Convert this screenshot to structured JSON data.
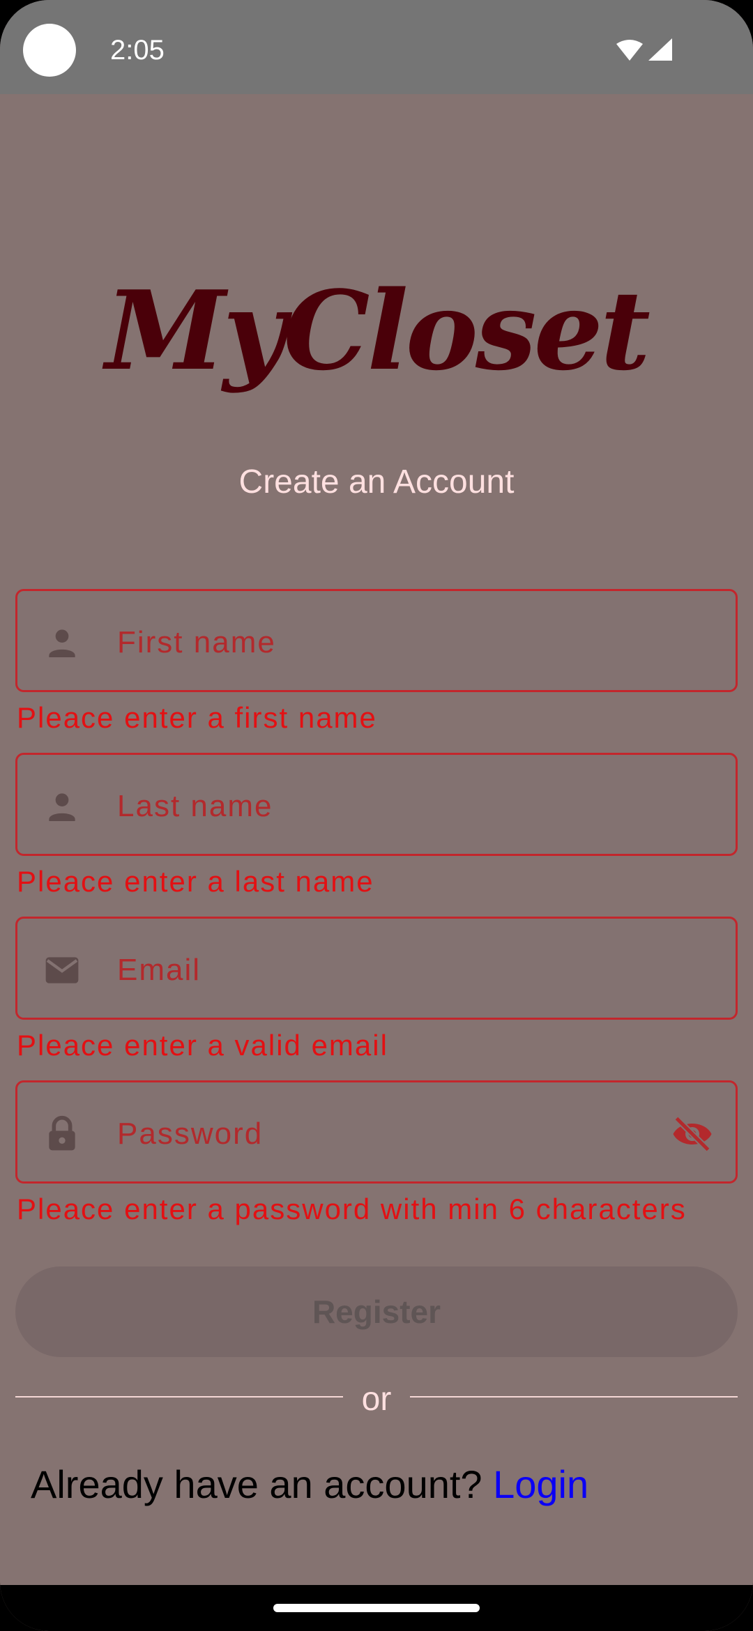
{
  "status_bar": {
    "time": "2:05",
    "icons": [
      "wifi-icon",
      "cell-signal-icon"
    ]
  },
  "app": {
    "logo": "MyCloset",
    "subtitle": "Create an Account"
  },
  "form": {
    "first_name": {
      "placeholder": "First name",
      "icon": "person-icon",
      "error": "Pleace enter a first name"
    },
    "last_name": {
      "placeholder": "Last name",
      "icon": "person-icon",
      "error": "Pleace enter a last name"
    },
    "email": {
      "placeholder": "Email",
      "icon": "mail-icon",
      "error": "Pleace enter a valid email"
    },
    "password": {
      "placeholder": "Password",
      "icon": "lock-icon",
      "toggle_icon": "eye-off-icon",
      "error": "Pleace enter a password with min 6 characters"
    },
    "register_label": "Register",
    "divider_label": "or"
  },
  "login_prompt": {
    "text": "Already have an account? ",
    "link": "Login"
  },
  "colors": {
    "background": "#857371",
    "status_bar": "#757575",
    "logo": "#4a0009",
    "field_border": "#c3262c",
    "error": "#e31013",
    "link": "#0a00f5"
  }
}
